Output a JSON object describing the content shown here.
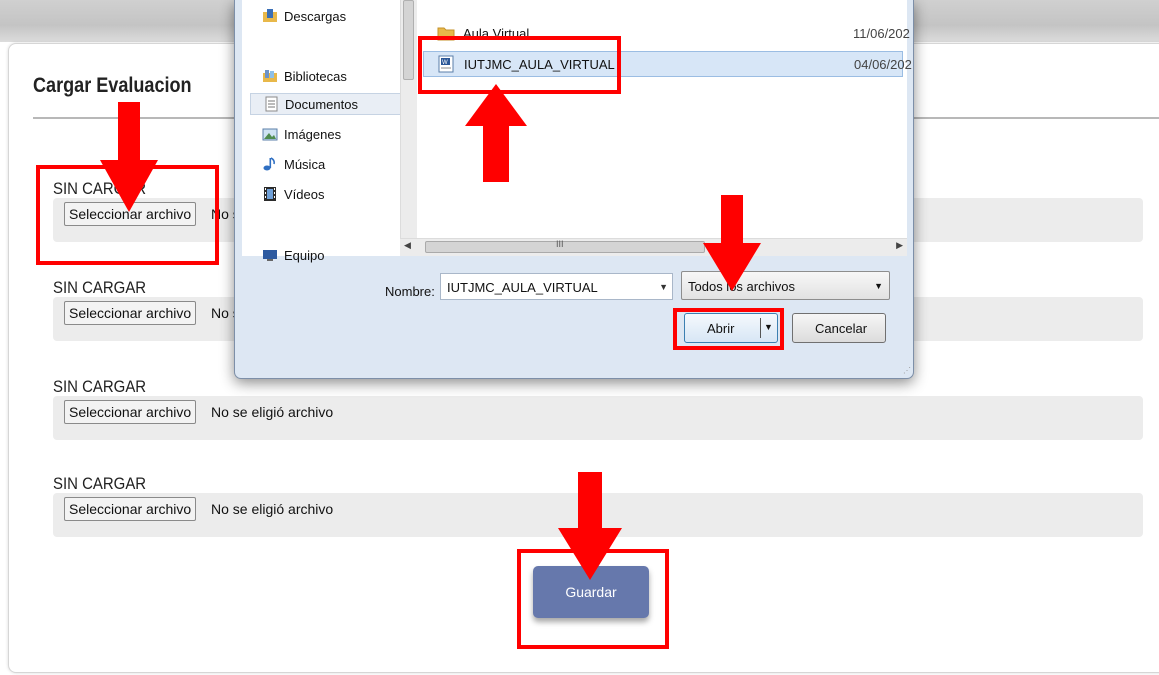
{
  "page": {
    "title": "Cargar Evaluacion",
    "uploads": [
      {
        "status": "SIN CARGAR",
        "button": "Seleccionar archivo",
        "file_text": "No se eligió archivo"
      },
      {
        "status": "SIN CARGAR",
        "button": "Seleccionar archivo",
        "file_text": "No se eligió archivo"
      },
      {
        "status": "SIN CARGAR",
        "button": "Seleccionar archivo",
        "file_text": "No se eligió archivo"
      },
      {
        "status": "SIN CARGAR",
        "button": "Seleccionar archivo",
        "file_text": "No se eligió archivo"
      }
    ],
    "save_button": "Guardar"
  },
  "dialog": {
    "nav": [
      {
        "label": "Descargas",
        "icon": "downloads-folder-icon"
      },
      {
        "label": "Bibliotecas",
        "icon": "libraries-icon"
      },
      {
        "label": "Documentos",
        "icon": "documents-icon"
      },
      {
        "label": "Imágenes",
        "icon": "pictures-icon"
      },
      {
        "label": "Música",
        "icon": "music-icon"
      },
      {
        "label": "Vídeos",
        "icon": "videos-icon"
      },
      {
        "label": "Equipo",
        "icon": "computer-icon"
      }
    ],
    "files": [
      {
        "name": "Aula Virtual",
        "date": "11/06/202",
        "icon": "folder-icon"
      },
      {
        "name": "IUTJMC_AULA_VIRTUAL",
        "date": "04/06/202",
        "icon": "word-document-icon"
      }
    ],
    "name_label": "Nombre:",
    "name_value": "IUTJMC_AULA_VIRTUAL",
    "type_value": "Todos los archivos",
    "open_button": "Abrir",
    "cancel_button": "Cancelar",
    "scroll_mark": "III"
  },
  "colors": {
    "annotation": "#ff0000",
    "save_button": "#6678ac"
  }
}
